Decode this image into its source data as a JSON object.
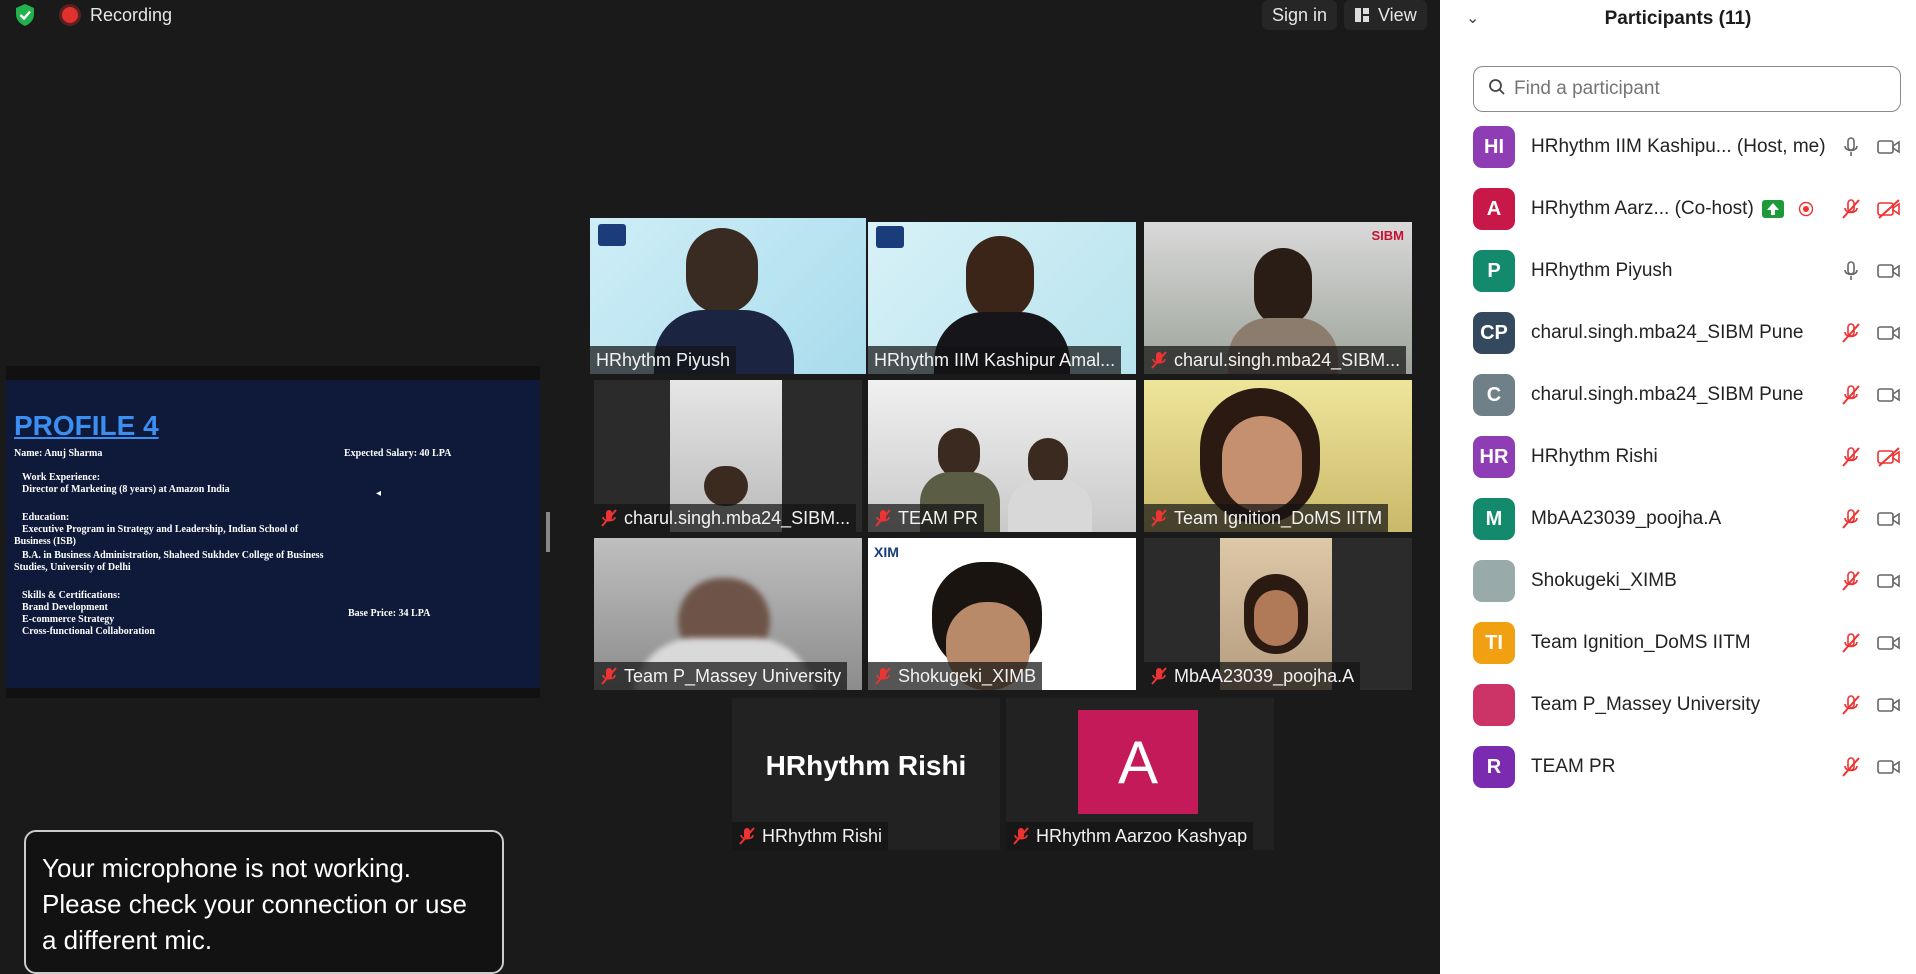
{
  "topbar": {
    "recording_label": "Recording",
    "sign_in_label": "Sign in",
    "view_label": "View"
  },
  "shared_screen": {
    "heading": "PROFILE 4",
    "lines": [
      "Name: Anuj Sharma",
      "Expected Salary: 40 LPA",
      "Work Experience:",
      "Director of Marketing (8 years) at Amazon India",
      "Education:",
      "Executive Program in Strategy and Leadership, Indian School of",
      "Business (ISB)",
      "B.A. in Business Administration, Shaheed Sukhdev College of Business",
      "Studies, University of Delhi",
      "Skills & Certifications:",
      "Brand Development",
      "E-commerce Strategy",
      "Cross-functional Collaboration",
      "Base Price: 34 LPA"
    ]
  },
  "video_tiles": [
    {
      "name": "HRhythm Piyush",
      "muted": false
    },
    {
      "name": "HRhythm IIM Kashipur Amal...",
      "muted": false
    },
    {
      "name": "charul.singh.mba24_SIBM...",
      "muted": true
    },
    {
      "name": "charul.singh.mba24_SIBM...",
      "muted": true
    },
    {
      "name": "TEAM PR",
      "muted": true
    },
    {
      "name": "Team Ignition_DoMS IITM",
      "muted": true
    },
    {
      "name": "Team P_Massey University",
      "muted": true
    },
    {
      "name": "Shokugeki_XIMB",
      "muted": true
    },
    {
      "name": "MbAA23039_poojha.A",
      "muted": true
    },
    {
      "name": "HRhythm Rishi",
      "muted": true,
      "display_text": "HRhythm Rishi"
    },
    {
      "name": "HRhythm Aarzoo Kashyap",
      "muted": true,
      "avatar_letter": "A"
    }
  ],
  "toast": {
    "message": "Your microphone is not working. Please check your connection or use a different mic."
  },
  "participants_panel": {
    "title": "Participants (11)",
    "search_placeholder": "Find a participant",
    "participants": [
      {
        "initials": "HI",
        "color": "#8e3db4",
        "name": "HRhythm IIM Kashipu...",
        "role": "(Host, me)",
        "mic": "on",
        "video": "off"
      },
      {
        "initials": "A",
        "color": "#c8184a",
        "name": "HRhythm Aarz...",
        "role": "(Co-host)",
        "mic": "muted",
        "video": "stopped"
      },
      {
        "initials": "P",
        "color": "#138a6b",
        "name": "HRhythm Piyush",
        "role": "",
        "mic": "on",
        "video": "on"
      },
      {
        "initials": "CP",
        "color": "#34485e",
        "name": "charul.singh.mba24_SIBM Pune",
        "role": "",
        "mic": "muted",
        "video": "on"
      },
      {
        "initials": "C",
        "color": "#6f8089",
        "name": "charul.singh.mba24_SIBM Pune",
        "role": "",
        "mic": "muted",
        "video": "on"
      },
      {
        "initials": "HR",
        "color": "#8e3db4",
        "name": "HRhythm Rishi",
        "role": "",
        "mic": "muted",
        "video": "stopped"
      },
      {
        "initials": "M",
        "color": "#138a6b",
        "name": "MbAA23039_poojha.A",
        "role": "",
        "mic": "muted",
        "video": "on"
      },
      {
        "initials": "",
        "color": "#9aa",
        "name": "Shokugeki_XIMB",
        "role": "",
        "mic": "muted",
        "video": "on"
      },
      {
        "initials": "TI",
        "color": "#f0a010",
        "name": "Team Ignition_DoMS IITM",
        "role": "",
        "mic": "muted",
        "video": "on"
      },
      {
        "initials": "",
        "color": "#c36",
        "name": "Team P_Massey University",
        "role": "",
        "mic": "muted",
        "video": "on"
      },
      {
        "initials": "R",
        "color": "#7a2bb0",
        "name": "TEAM PR",
        "role": "",
        "mic": "muted",
        "video": "on"
      }
    ]
  }
}
